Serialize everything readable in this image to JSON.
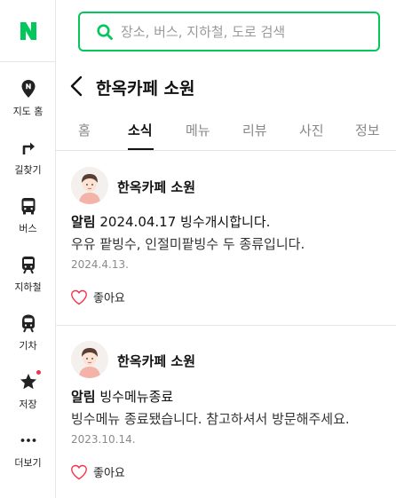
{
  "brand": {
    "logo_letter": "N",
    "accent": "#03c75a"
  },
  "sidebar": {
    "items": [
      {
        "label": "지도 홈",
        "icon": "map-pin-icon"
      },
      {
        "label": "길찾기",
        "icon": "directions-icon"
      },
      {
        "label": "버스",
        "icon": "bus-icon"
      },
      {
        "label": "지하철",
        "icon": "subway-icon"
      },
      {
        "label": "기차",
        "icon": "train-icon"
      },
      {
        "label": "저장",
        "icon": "star-icon",
        "has_notification_dot": true
      },
      {
        "label": "더보기",
        "icon": "more-icon"
      }
    ]
  },
  "search": {
    "placeholder": "장소, 버스, 지하철, 도로 검색",
    "value": ""
  },
  "place": {
    "title": "한옥카페 소원"
  },
  "tabs": {
    "items": [
      "홈",
      "소식",
      "메뉴",
      "리뷰",
      "사진",
      "정보"
    ],
    "active": "소식"
  },
  "posts": [
    {
      "author": "한옥카페 소원",
      "tag": "알림",
      "headline": " 2024.04.17 빙수개시합니다.",
      "body": "우유 팥빙수, 인절미팥빙수 두 종류입니다.",
      "date": "2024.4.13.",
      "like_label": "좋아요"
    },
    {
      "author": "한옥카페 소원",
      "tag": "알림",
      "headline": " 빙수메뉴종료",
      "body": "빙수메뉴 종료됐습니다. 참고하셔서 방문해주세요.",
      "date": "2023.10.14.",
      "like_label": "좋아요"
    }
  ]
}
